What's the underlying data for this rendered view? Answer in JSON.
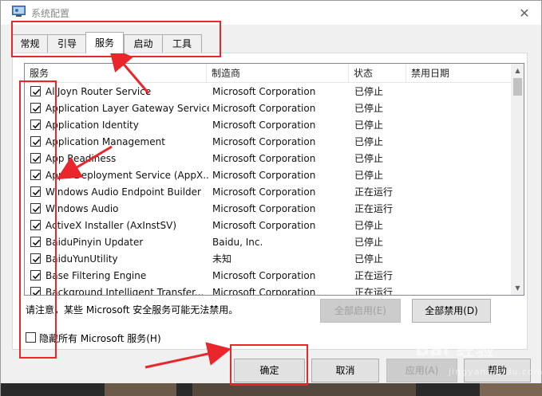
{
  "window": {
    "title": "系统配置",
    "close_glyph": "✕"
  },
  "tabs": [
    {
      "label": "常规",
      "active": false
    },
    {
      "label": "引导",
      "active": false
    },
    {
      "label": "服务",
      "active": true
    },
    {
      "label": "启动",
      "active": false
    },
    {
      "label": "工具",
      "active": false
    }
  ],
  "services_table": {
    "headers": [
      "服务",
      "制造商",
      "状态",
      "禁用日期"
    ],
    "rows": [
      {
        "name": "AllJoyn Router Service",
        "manufacturer": "Microsoft Corporation",
        "status": "已停止",
        "disabled_date": "",
        "checked": true
      },
      {
        "name": "Application Layer Gateway Service",
        "manufacturer": "Microsoft Corporation",
        "status": "已停止",
        "disabled_date": "",
        "checked": true
      },
      {
        "name": "Application Identity",
        "manufacturer": "Microsoft Corporation",
        "status": "已停止",
        "disabled_date": "",
        "checked": true
      },
      {
        "name": "Application Management",
        "manufacturer": "Microsoft Corporation",
        "status": "已停止",
        "disabled_date": "",
        "checked": true
      },
      {
        "name": "App Readiness",
        "manufacturer": "Microsoft Corporation",
        "status": "已停止",
        "disabled_date": "",
        "checked": true
      },
      {
        "name": "AppX Deployment Service (AppX...",
        "manufacturer": "Microsoft Corporation",
        "status": "已停止",
        "disabled_date": "",
        "checked": true
      },
      {
        "name": "Windows Audio Endpoint Builder",
        "manufacturer": "Microsoft Corporation",
        "status": "正在运行",
        "disabled_date": "",
        "checked": true
      },
      {
        "name": "Windows Audio",
        "manufacturer": "Microsoft Corporation",
        "status": "正在运行",
        "disabled_date": "",
        "checked": true
      },
      {
        "name": "ActiveX Installer (AxInstSV)",
        "manufacturer": "Microsoft Corporation",
        "status": "已停止",
        "disabled_date": "",
        "checked": true
      },
      {
        "name": "BaiduPinyin Updater",
        "manufacturer": "Baidu, Inc.",
        "status": "已停止",
        "disabled_date": "",
        "checked": true
      },
      {
        "name": "BaiduYunUtility",
        "manufacturer": "未知",
        "status": "已停止",
        "disabled_date": "",
        "checked": true
      },
      {
        "name": "Base Filtering Engine",
        "manufacturer": "Microsoft Corporation",
        "status": "正在运行",
        "disabled_date": "",
        "checked": true
      },
      {
        "name": "Background Intelligent Transfer...",
        "manufacturer": "Microsoft Corporation",
        "status": "正在运行",
        "disabled_date": "",
        "checked": true
      }
    ]
  },
  "notice": "请注意，某些 Microsoft 安全服务可能无法禁用。",
  "buttons": {
    "enable_all": "全部启用(E)",
    "disable_all": "全部禁用(D)",
    "ok": "确定",
    "cancel": "取消",
    "apply": "应用(A)",
    "help": "帮助"
  },
  "hide_ms_checkbox": {
    "label": "隐藏所有 Microsoft 服务(H)",
    "checked": false
  },
  "watermark": {
    "logo": "Bai 经验",
    "sub": "jingyan.baidu.com"
  },
  "colors": {
    "annotation": "#e8262c",
    "window_bg": "#f0f0f0",
    "button_bg": "#e1e1e1"
  }
}
